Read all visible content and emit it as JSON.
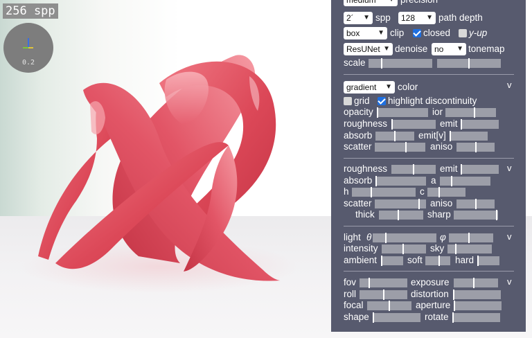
{
  "viewport": {
    "spp_text": "256 spp",
    "gizmo_value": "0.2"
  },
  "render": {
    "precision_value": "medium",
    "precision_label": "precision",
    "spp_value": "2´",
    "spp_label": "spp",
    "path_depth_value": "128",
    "path_depth_label": "path depth",
    "clip_value": "box",
    "clip_label": "clip",
    "closed_label": "closed",
    "closed_checked": true,
    "yup_label": "y-up",
    "yup_checked": false,
    "denoise_value": "ResUNet",
    "denoise_label": "denoise",
    "tonemap_value": "no",
    "tonemap_label": "tonemap",
    "scale_label": "scale",
    "scale_1": 0.2,
    "scale_2": 0.5
  },
  "material": {
    "color_value": "gradient",
    "color_label": "color",
    "collapse_label": "v",
    "grid_label": "grid",
    "grid_checked": false,
    "highlight_label": "highlight discontinuity",
    "highlight_checked": true,
    "sliders": [
      {
        "label": "opacity",
        "value": 0.0
      },
      {
        "label": "ior",
        "value": 0.58
      },
      {
        "label": "roughness",
        "value": 0.0
      },
      {
        "label": "emit",
        "value": 0.0
      },
      {
        "label": "absorb",
        "value": 0.5
      },
      {
        "label": "emit[v]",
        "value": 0.0
      },
      {
        "label": "scatter",
        "value": 0.62
      },
      {
        "label": "aniso",
        "value": 0.5
      }
    ]
  },
  "medium": {
    "collapse_label": "v",
    "sliders": [
      {
        "label": "roughness",
        "value": 0.5
      },
      {
        "label": "emit",
        "value": 0.0
      },
      {
        "label": "absorb",
        "value": 0.0
      },
      {
        "label": "a",
        "value": 0.22
      },
      {
        "label": "h",
        "value": 0.3
      },
      {
        "label": "c",
        "value": 0.3
      },
      {
        "label": "scatter",
        "value": 0.88
      },
      {
        "label": "aniso",
        "value": 0.5
      },
      {
        "label": "thick",
        "value": 0.43
      },
      {
        "label": "sharp",
        "value": 0.98
      }
    ]
  },
  "lighting": {
    "collapse_label": "v",
    "light_label": "light",
    "theta_symbol": "θ",
    "phi_symbol": "φ",
    "sliders": [
      {
        "label": "light_theta",
        "value": 0.2
      },
      {
        "label": "phi",
        "value": 0.45
      },
      {
        "label": "intensity",
        "value": 0.48
      },
      {
        "label": "sky",
        "value": 0.18
      },
      {
        "label": "ambient",
        "value": 0.0
      },
      {
        "label": "soft",
        "value": 0.55
      },
      {
        "label": "hard",
        "value": 0.0
      }
    ],
    "intensity_label": "intensity",
    "sky_label": "sky",
    "ambient_label": "ambient",
    "soft_label": "soft",
    "hard_label": "hard"
  },
  "camera": {
    "collapse_label": "v",
    "sliders": [
      {
        "label": "fov",
        "value": 0.2
      },
      {
        "label": "exposure",
        "value": 0.45
      },
      {
        "label": "roll",
        "value": 0.5
      },
      {
        "label": "distortion",
        "value": 0.0
      },
      {
        "label": "focal",
        "value": 0.5
      },
      {
        "label": "aperture",
        "value": 0.0
      },
      {
        "label": "shape",
        "value": 0.0
      },
      {
        "label": "rotate",
        "value": 0.0
      }
    ]
  },
  "colors": {
    "panel_bg": "#575a6e",
    "object_red": "#dc4a5b",
    "checkbox_on": "#1e6fe0"
  }
}
